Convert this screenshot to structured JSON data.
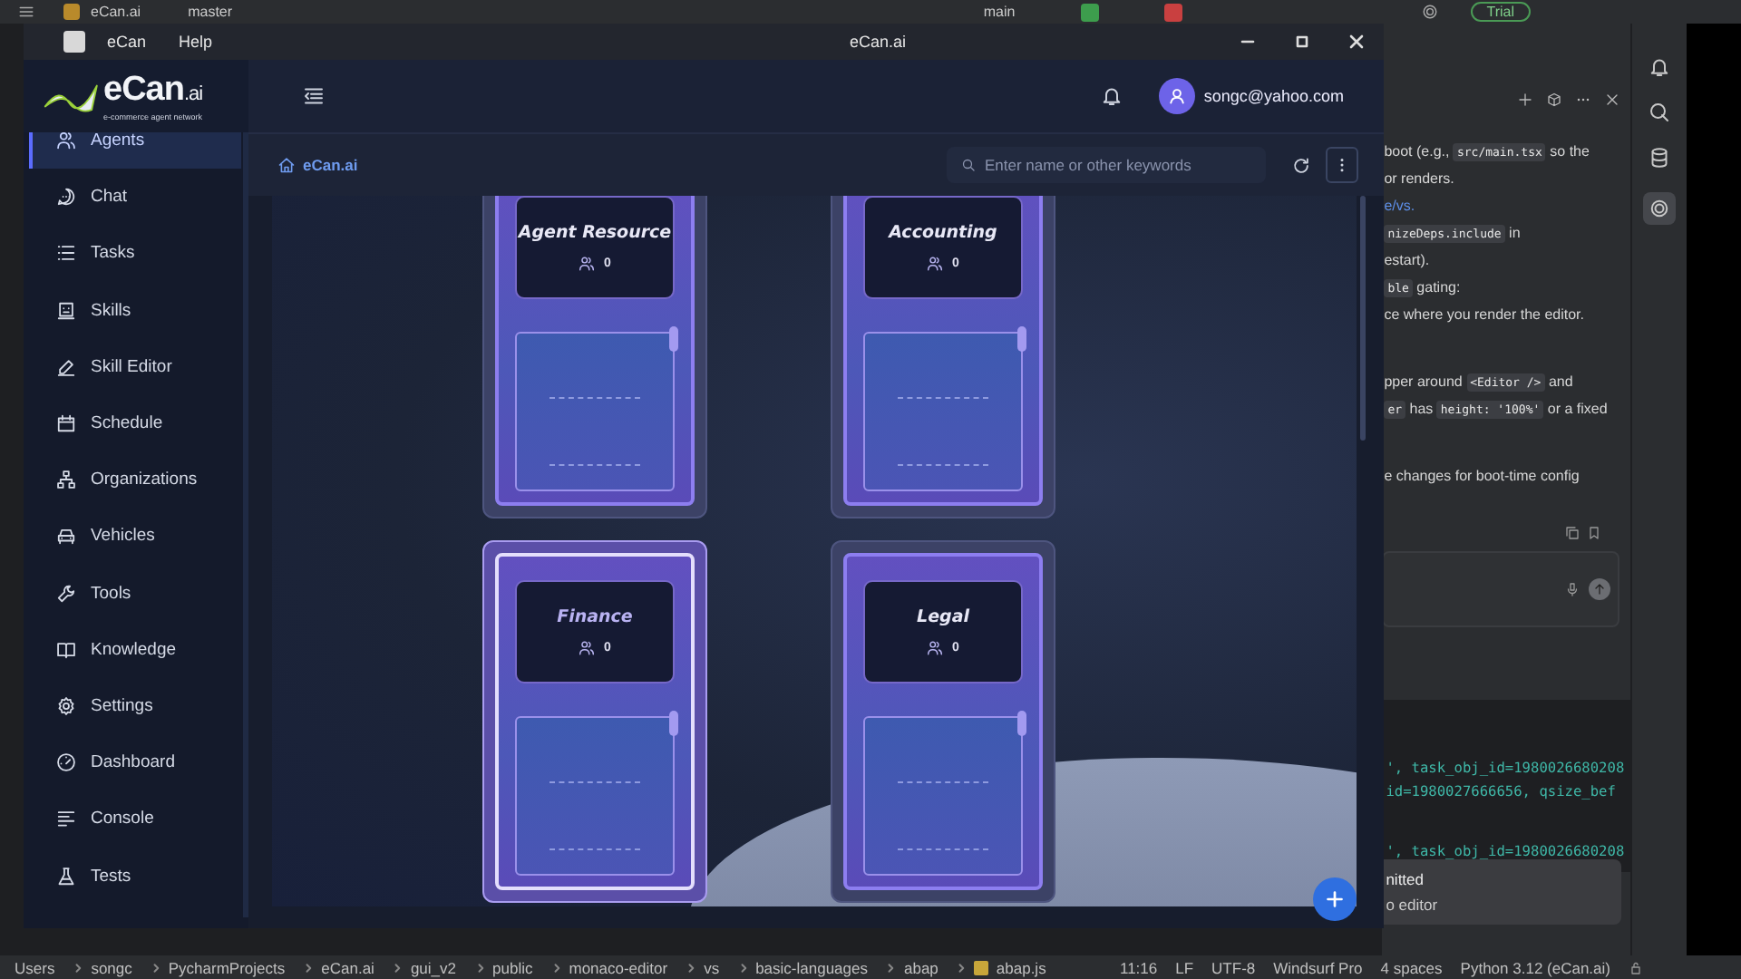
{
  "ide": {
    "top_bar": {
      "project": "eCan.ai",
      "branch": "master",
      "vcs_branch": "main",
      "trial": "Trial"
    },
    "assistant_panel": {
      "lines": [
        [
          {
            "kind": "text",
            "text": "boot (e.g., "
          },
          {
            "kind": "code",
            "text": "src/main.tsx"
          },
          {
            "kind": "text",
            "text": " so the"
          }
        ],
        [
          {
            "kind": "text",
            "text": "or renders."
          }
        ],
        [
          {
            "kind": "link",
            "text": "e/vs."
          }
        ],
        [
          {
            "kind": "code",
            "text": "nizeDeps.include"
          },
          {
            "kind": "text",
            "text": " in"
          }
        ],
        [
          {
            "kind": "text",
            "text": "estart)."
          }
        ],
        [
          {
            "kind": "code",
            "text": "ble"
          },
          {
            "kind": "text",
            "text": " gating:"
          }
        ],
        [
          {
            "kind": "text",
            "text": "ce where you render the editor."
          }
        ],
        [
          {
            "kind": "text",
            "text": "pper around "
          },
          {
            "kind": "code",
            "text": "<Editor />"
          },
          {
            "kind": "text",
            "text": " and"
          }
        ],
        [
          {
            "kind": "code",
            "text": "er"
          },
          {
            "kind": "text",
            "text": " has "
          },
          {
            "kind": "code",
            "text": "height: '100%'"
          },
          {
            "kind": "text",
            "text": " or a fixed"
          }
        ],
        [
          {
            "kind": "text",
            "text": "e changes for boot-time config"
          }
        ]
      ]
    },
    "terminal": {
      "lines": [
        "', task_obj_id=1980026680208",
        "id=1980027666656, qsize_bef",
        "', task_obj_id=1980026680208"
      ]
    },
    "notification": {
      "title": "nitted",
      "message": "o editor"
    },
    "status_bar": {
      "path": [
        "Users",
        "songc",
        "PycharmProjects",
        "eCan.ai",
        "gui_v2",
        "public",
        "monaco-editor",
        "vs",
        "basic-languages",
        "abap",
        "abap.js"
      ],
      "position": "11:16",
      "line_ending": "LF",
      "encoding": "UTF-8",
      "plugin": "Windsurf Pro",
      "indent": "4 spaces",
      "interpreter": "Python 3.12 (eCan.ai)"
    }
  },
  "app": {
    "window": {
      "title": "eCan.ai",
      "menu": [
        "eCan",
        "Help"
      ]
    },
    "logo": {
      "name": "eCan",
      "suffix": ".ai",
      "tagline": "e-commerce agent network"
    },
    "user": {
      "email": "songc@yahoo.com"
    },
    "sidebar": {
      "items": [
        {
          "label": "Agents",
          "selected": true
        },
        {
          "label": "Chat",
          "selected": false
        },
        {
          "label": "Tasks",
          "selected": false
        },
        {
          "label": "Skills",
          "selected": false
        },
        {
          "label": "Skill Editor",
          "selected": false
        },
        {
          "label": "Schedule",
          "selected": false
        },
        {
          "label": "Organizations",
          "selected": false
        },
        {
          "label": "Vehicles",
          "selected": false
        },
        {
          "label": "Tools",
          "selected": false
        },
        {
          "label": "Knowledge",
          "selected": false
        },
        {
          "label": "Settings",
          "selected": false
        },
        {
          "label": "Dashboard",
          "selected": false
        },
        {
          "label": "Console",
          "selected": false
        },
        {
          "label": "Tests",
          "selected": false
        }
      ]
    },
    "breadcrumb": "eCan.ai",
    "search": {
      "placeholder": "Enter name or other keywords"
    },
    "departments": [
      {
        "name": "Agent Resource",
        "count": "0",
        "selected": false
      },
      {
        "name": "Accounting",
        "count": "0",
        "selected": false
      },
      {
        "name": "Finance",
        "count": "0",
        "selected": true
      },
      {
        "name": "Legal",
        "count": "0",
        "selected": false
      }
    ]
  }
}
